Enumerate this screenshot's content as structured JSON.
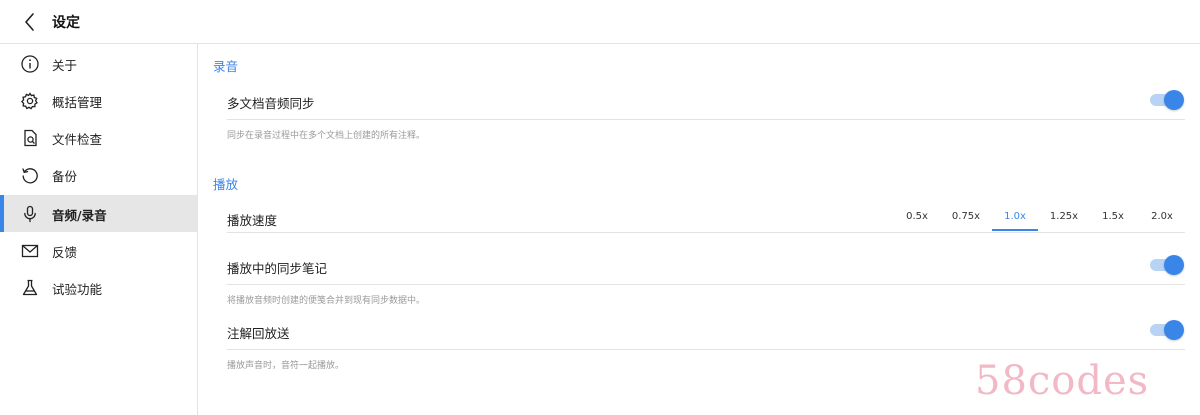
{
  "header": {
    "title": "设定",
    "back_icon": "chevron-left-icon"
  },
  "sidebar": {
    "items": [
      {
        "label": "关于",
        "icon": "info-icon",
        "active": false
      },
      {
        "label": "概括管理",
        "icon": "gear-icon",
        "active": false
      },
      {
        "label": "文件检查",
        "icon": "file-search-icon",
        "active": false
      },
      {
        "label": "备份",
        "icon": "backup-icon",
        "active": false
      },
      {
        "label": "音频/录音",
        "icon": "microphone-icon",
        "active": true
      },
      {
        "label": "反馈",
        "icon": "mail-icon",
        "active": false
      },
      {
        "label": "试验功能",
        "icon": "flask-icon",
        "active": false
      }
    ]
  },
  "content": {
    "recording": {
      "title": "录音",
      "multi_doc_sync": {
        "label": "多文档音频同步",
        "enabled": true,
        "description": "同步在录音过程中在多个文档上创建的所有注释。"
      }
    },
    "playback": {
      "title": "播放",
      "speed": {
        "label": "播放速度",
        "options": [
          "0.5x",
          "0.75x",
          "1.0x",
          "1.25x",
          "1.5x",
          "2.0x"
        ],
        "selected": "1.0x"
      },
      "sync_notes": {
        "label": "播放中的同步笔记",
        "enabled": true,
        "description": "将播放音频时创建的便笺合并到现有同步数据中。"
      },
      "annotation_playback": {
        "label": "注解回放送",
        "enabled": true,
        "description": "播放声音时，音符一起播放。"
      }
    }
  },
  "watermark": "58codes",
  "colors": {
    "accent": "#3a86e8",
    "toggle_track": "#b9d3f5",
    "active_item_bg": "#e6e6e6",
    "watermark": "#f2b8c6"
  }
}
